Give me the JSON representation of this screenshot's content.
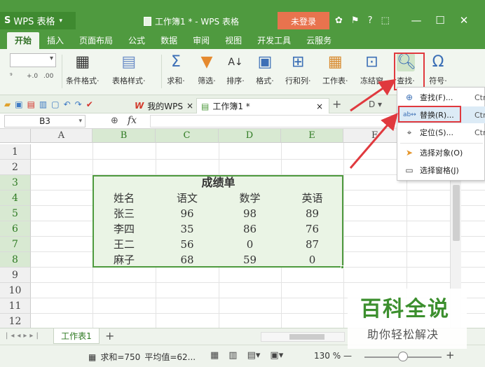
{
  "titlebar": {
    "app_menu": "WPS 表格",
    "logo": "S",
    "window_title": "工作簿1 * - WPS 表格",
    "login_label": "未登录",
    "help": "?",
    "win_min": "—",
    "win_max": "☐",
    "win_close": "✕"
  },
  "menu": {
    "tabs": [
      "开始",
      "插入",
      "页面布局",
      "公式",
      "数据",
      "审阅",
      "视图",
      "开发工具",
      "云服务"
    ],
    "active": "开始"
  },
  "ribbon": {
    "small_labels": [
      ".00",
      "+.0"
    ],
    "buttons": [
      {
        "label": "条件格式·",
        "icon": "conditional-format"
      },
      {
        "label": "表格样式·",
        "icon": "table-style"
      },
      {
        "label": "求和·",
        "icon": "sum",
        "glyph": "Σ"
      },
      {
        "label": "筛选·",
        "icon": "filter"
      },
      {
        "label": "排序·",
        "icon": "sort"
      },
      {
        "label": "格式·",
        "icon": "format"
      },
      {
        "label": "行和列·",
        "icon": "rows-cols"
      },
      {
        "label": "工作表·",
        "icon": "worksheet"
      },
      {
        "label": "冻结窗",
        "icon": "freeze"
      },
      {
        "label": "查找·",
        "icon": "find"
      },
      {
        "label": "符号·",
        "icon": "symbol",
        "glyph": "Ω"
      }
    ]
  },
  "doctabs": {
    "mywps_label": "我的WPS",
    "book_label": "工作簿1 *",
    "close": "×",
    "add": "+",
    "right_icons": "D ▾"
  },
  "formula": {
    "name_box": "B3",
    "fx": "fx",
    "value": ""
  },
  "grid": {
    "columns": [
      "A",
      "B",
      "C",
      "D",
      "E",
      "F"
    ],
    "rows": [
      "1",
      "2",
      "3",
      "4",
      "5",
      "6",
      "7",
      "8",
      "9",
      "10",
      "11",
      "12"
    ],
    "table_title": "成绩单",
    "headers": [
      "姓名",
      "语文",
      "数学",
      "英语"
    ],
    "records": [
      [
        "张三",
        "96",
        "98",
        "89"
      ],
      [
        "李四",
        "35",
        "86",
        "76"
      ],
      [
        "王二",
        "56",
        "0",
        "87"
      ],
      [
        "麻子",
        "68",
        "59",
        "0"
      ]
    ]
  },
  "dropdown": {
    "items": [
      {
        "label": "查找(F)...",
        "shortcut": "Ctr",
        "icon": "find-icon"
      },
      {
        "label": "替换(R)...",
        "shortcut": "Ctr",
        "icon": "replace-icon"
      },
      {
        "label": "定位(S)...",
        "shortcut": "Ctr",
        "icon": "goto-icon"
      },
      {
        "label": "选择对象(O)",
        "shortcut": "",
        "icon": "select-object-icon"
      },
      {
        "label": "选择窗格(J)",
        "shortcut": "",
        "icon": "select-pane-icon"
      }
    ]
  },
  "sheets": {
    "tabs": [
      "工作表1"
    ],
    "add": "+"
  },
  "status": {
    "sum": "求和=750",
    "avg": "平均值=62...",
    "zoom": "130 %",
    "zoom_minus": "—",
    "zoom_plus": "+"
  },
  "watermark": {
    "main": "百科全说",
    "sub": "助你轻松解决"
  },
  "colors": {
    "brand_green": "#4f9a3f",
    "login_orange": "#e8734e",
    "highlight_red": "#e0393e"
  }
}
